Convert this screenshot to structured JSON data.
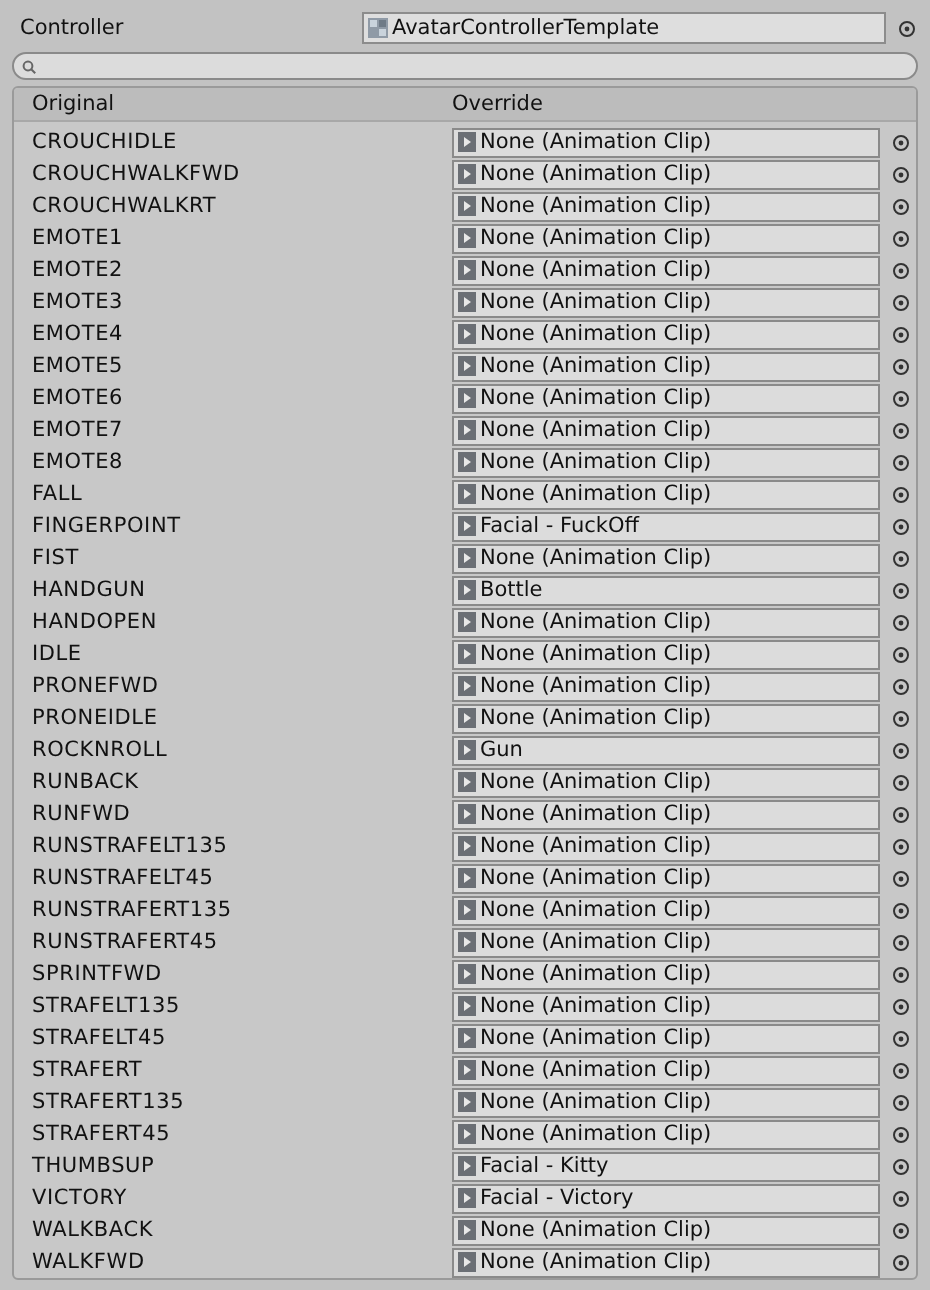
{
  "controller": {
    "label": "Controller",
    "value": "AvatarControllerTemplate"
  },
  "table": {
    "columns": [
      "Original",
      "Override"
    ],
    "rows": [
      {
        "original": "CROUCHIDLE",
        "override": "None (Animation Clip)"
      },
      {
        "original": "CROUCHWALKFWD",
        "override": "None (Animation Clip)"
      },
      {
        "original": "CROUCHWALKRT",
        "override": "None (Animation Clip)"
      },
      {
        "original": "EMOTE1",
        "override": "None (Animation Clip)"
      },
      {
        "original": "EMOTE2",
        "override": "None (Animation Clip)"
      },
      {
        "original": "EMOTE3",
        "override": "None (Animation Clip)"
      },
      {
        "original": "EMOTE4",
        "override": "None (Animation Clip)"
      },
      {
        "original": "EMOTE5",
        "override": "None (Animation Clip)"
      },
      {
        "original": "EMOTE6",
        "override": "None (Animation Clip)"
      },
      {
        "original": "EMOTE7",
        "override": "None (Animation Clip)"
      },
      {
        "original": "EMOTE8",
        "override": "None (Animation Clip)"
      },
      {
        "original": "FALL",
        "override": "None (Animation Clip)"
      },
      {
        "original": "FINGERPOINT",
        "override": "Facial - FuckOff"
      },
      {
        "original": "FIST",
        "override": "None (Animation Clip)"
      },
      {
        "original": "HANDGUN",
        "override": "Bottle"
      },
      {
        "original": "HANDOPEN",
        "override": "None (Animation Clip)"
      },
      {
        "original": "IDLE",
        "override": "None (Animation Clip)"
      },
      {
        "original": "PRONEFWD",
        "override": "None (Animation Clip)"
      },
      {
        "original": "PRONEIDLE",
        "override": "None (Animation Clip)"
      },
      {
        "original": "ROCKNROLL",
        "override": "Gun"
      },
      {
        "original": "RUNBACK",
        "override": "None (Animation Clip)"
      },
      {
        "original": "RUNFWD",
        "override": "None (Animation Clip)"
      },
      {
        "original": "RUNSTRAFELT135",
        "override": "None (Animation Clip)"
      },
      {
        "original": "RUNSTRAFELT45",
        "override": "None (Animation Clip)"
      },
      {
        "original": "RUNSTRAFERT135",
        "override": "None (Animation Clip)"
      },
      {
        "original": "RUNSTRAFERT45",
        "override": "None (Animation Clip)"
      },
      {
        "original": "SPRINTFWD",
        "override": "None (Animation Clip)"
      },
      {
        "original": "STRAFELT135",
        "override": "None (Animation Clip)"
      },
      {
        "original": "STRAFELT45",
        "override": "None (Animation Clip)"
      },
      {
        "original": "STRAFERT",
        "override": "None (Animation Clip)"
      },
      {
        "original": "STRAFERT135",
        "override": "None (Animation Clip)"
      },
      {
        "original": "STRAFERT45",
        "override": "None (Animation Clip)"
      },
      {
        "original": "THUMBSUP",
        "override": "Facial - Kitty"
      },
      {
        "original": "VICTORY",
        "override": "Facial - Victory"
      },
      {
        "original": "WALKBACK",
        "override": "None (Animation Clip)"
      },
      {
        "original": "WALKFWD",
        "override": "None (Animation Clip)"
      }
    ]
  }
}
